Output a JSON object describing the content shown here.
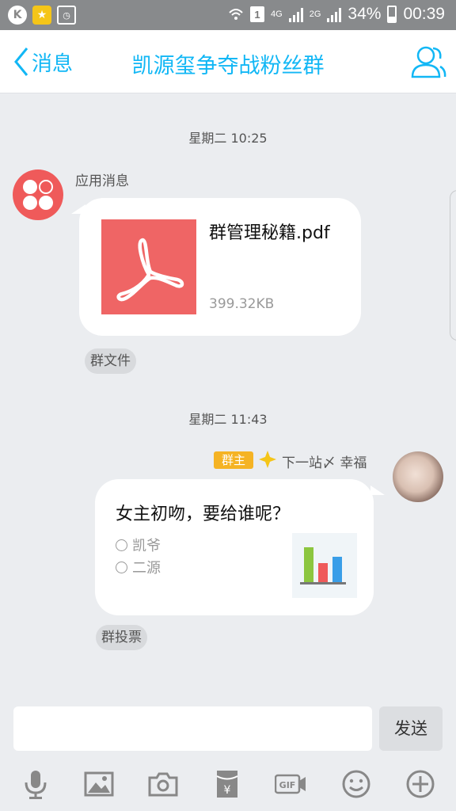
{
  "status_bar": {
    "left_icons": [
      "k-app-icon",
      "star-app-icon",
      "doc-clock-icon"
    ],
    "sim_badge": "1",
    "network": "4G",
    "network2": "2G",
    "battery": "34%",
    "time": "00:39"
  },
  "header": {
    "back_label": "消息",
    "title": "凯源玺争夺战粉丝群"
  },
  "messages": [
    {
      "time": "星期二 10:25",
      "sender": "应用消息",
      "file_name": "群管理秘籍.pdf",
      "file_size": "399.32KB",
      "tag": "群文件"
    },
    {
      "time": "星期二 11:43",
      "role_badge": "群主",
      "sender": "下一站〆 幸福",
      "question": "女主初吻，要给谁呢？",
      "options": [
        "凯爷",
        "二源"
      ],
      "tag": "群投票"
    }
  ],
  "composer": {
    "input_value": "",
    "send_label": "发送"
  },
  "toolbar_icons": [
    "microphone-icon",
    "image-icon",
    "camera-icon",
    "red-packet-icon",
    "gif-icon",
    "emoji-icon",
    "plus-icon"
  ],
  "colors": {
    "accent": "#12b7f5",
    "pdf_red": "#ef6565",
    "owner_badge": "#f5b324",
    "background": "#ebedf0"
  }
}
